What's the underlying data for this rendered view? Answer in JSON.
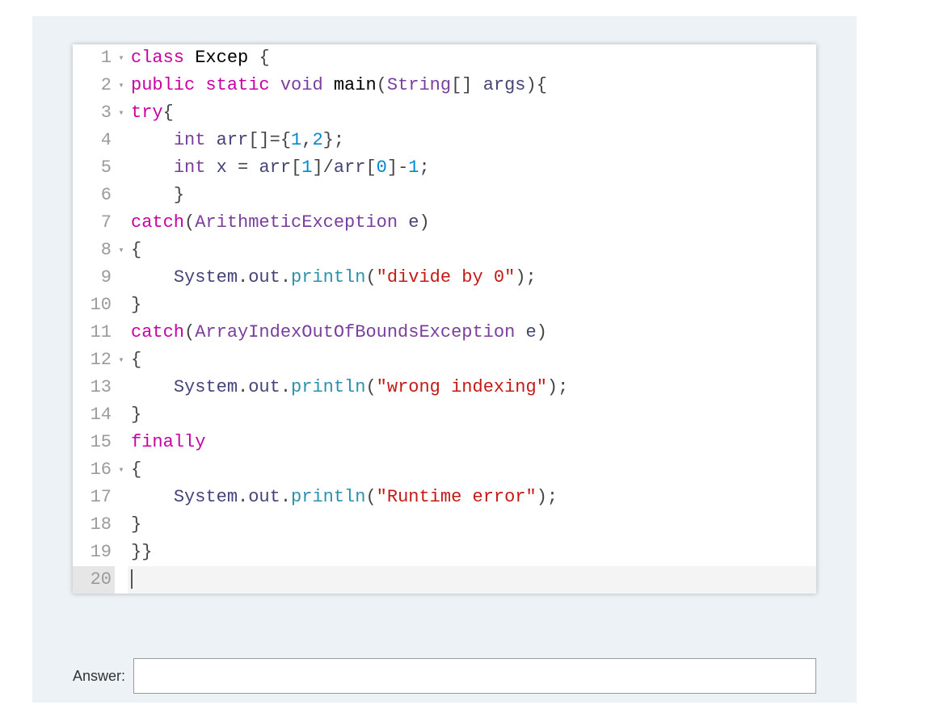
{
  "code": {
    "lines": [
      {
        "n": "1",
        "fold": true,
        "tokens": [
          {
            "c": "tok-kw",
            "t": "class"
          },
          {
            "c": "",
            "t": " "
          },
          {
            "c": "tok-name",
            "t": "Excep"
          },
          {
            "c": "",
            "t": " "
          },
          {
            "c": "tok-brace",
            "t": "{"
          }
        ]
      },
      {
        "n": "2",
        "fold": true,
        "tokens": [
          {
            "c": "tok-kw",
            "t": "public"
          },
          {
            "c": "",
            "t": " "
          },
          {
            "c": "tok-kw",
            "t": "static"
          },
          {
            "c": "",
            "t": " "
          },
          {
            "c": "tok-type",
            "t": "void"
          },
          {
            "c": "",
            "t": " "
          },
          {
            "c": "tok-name",
            "t": "main"
          },
          {
            "c": "tok-pun",
            "t": "("
          },
          {
            "c": "tok-type",
            "t": "String"
          },
          {
            "c": "tok-pun",
            "t": "[]"
          },
          {
            "c": "",
            "t": " "
          },
          {
            "c": "tok-id",
            "t": "args"
          },
          {
            "c": "tok-pun",
            "t": ")"
          },
          {
            "c": "tok-brace",
            "t": "{"
          }
        ]
      },
      {
        "n": "3",
        "fold": true,
        "tokens": [
          {
            "c": "tok-kw",
            "t": "try"
          },
          {
            "c": "tok-brace",
            "t": "{"
          }
        ]
      },
      {
        "n": "4",
        "fold": false,
        "tokens": [
          {
            "c": "",
            "t": "    "
          },
          {
            "c": "tok-type",
            "t": "int"
          },
          {
            "c": "",
            "t": " "
          },
          {
            "c": "tok-id",
            "t": "arr"
          },
          {
            "c": "tok-pun",
            "t": "[]="
          },
          {
            "c": "tok-brace",
            "t": "{"
          },
          {
            "c": "tok-num",
            "t": "1"
          },
          {
            "c": "tok-pun",
            "t": ","
          },
          {
            "c": "tok-num",
            "t": "2"
          },
          {
            "c": "tok-brace",
            "t": "}"
          },
          {
            "c": "tok-pun",
            "t": ";"
          }
        ]
      },
      {
        "n": "5",
        "fold": false,
        "tokens": [
          {
            "c": "",
            "t": "    "
          },
          {
            "c": "tok-type",
            "t": "int"
          },
          {
            "c": "",
            "t": " "
          },
          {
            "c": "tok-id",
            "t": "x"
          },
          {
            "c": "",
            "t": " "
          },
          {
            "c": "tok-pun",
            "t": "="
          },
          {
            "c": "",
            "t": " "
          },
          {
            "c": "tok-id",
            "t": "arr"
          },
          {
            "c": "tok-pun",
            "t": "["
          },
          {
            "c": "tok-num",
            "t": "1"
          },
          {
            "c": "tok-pun",
            "t": "]/"
          },
          {
            "c": "tok-id",
            "t": "arr"
          },
          {
            "c": "tok-pun",
            "t": "["
          },
          {
            "c": "tok-num",
            "t": "0"
          },
          {
            "c": "tok-pun",
            "t": "]-"
          },
          {
            "c": "tok-num",
            "t": "1"
          },
          {
            "c": "tok-pun",
            "t": ";"
          }
        ]
      },
      {
        "n": "6",
        "fold": false,
        "tokens": [
          {
            "c": "",
            "t": "    "
          },
          {
            "c": "tok-brace",
            "t": "}"
          }
        ]
      },
      {
        "n": "7",
        "fold": false,
        "tokens": [
          {
            "c": "tok-kw",
            "t": "catch"
          },
          {
            "c": "tok-pun",
            "t": "("
          },
          {
            "c": "tok-type",
            "t": "ArithmeticException"
          },
          {
            "c": "",
            "t": " "
          },
          {
            "c": "tok-id",
            "t": "e"
          },
          {
            "c": "tok-pun",
            "t": ")"
          }
        ]
      },
      {
        "n": "8",
        "fold": true,
        "tokens": [
          {
            "c": "tok-brace",
            "t": "{"
          }
        ]
      },
      {
        "n": "9",
        "fold": false,
        "tokens": [
          {
            "c": "",
            "t": "    "
          },
          {
            "c": "tok-id",
            "t": "System"
          },
          {
            "c": "tok-pun",
            "t": "."
          },
          {
            "c": "tok-id",
            "t": "out"
          },
          {
            "c": "tok-pun",
            "t": "."
          },
          {
            "c": "tok-call",
            "t": "println"
          },
          {
            "c": "tok-pun",
            "t": "("
          },
          {
            "c": "tok-str",
            "t": "\"divide by 0\""
          },
          {
            "c": "tok-pun",
            "t": ");"
          }
        ]
      },
      {
        "n": "10",
        "fold": false,
        "tokens": [
          {
            "c": "tok-brace",
            "t": "}"
          }
        ]
      },
      {
        "n": "11",
        "fold": false,
        "tokens": [
          {
            "c": "tok-kw",
            "t": "catch"
          },
          {
            "c": "tok-pun",
            "t": "("
          },
          {
            "c": "tok-type",
            "t": "ArrayIndexOutOfBoundsException"
          },
          {
            "c": "",
            "t": " "
          },
          {
            "c": "tok-id",
            "t": "e"
          },
          {
            "c": "tok-pun",
            "t": ")"
          }
        ]
      },
      {
        "n": "12",
        "fold": true,
        "tokens": [
          {
            "c": "tok-brace",
            "t": "{"
          }
        ]
      },
      {
        "n": "13",
        "fold": false,
        "tokens": [
          {
            "c": "",
            "t": "    "
          },
          {
            "c": "tok-id",
            "t": "System"
          },
          {
            "c": "tok-pun",
            "t": "."
          },
          {
            "c": "tok-id",
            "t": "out"
          },
          {
            "c": "tok-pun",
            "t": "."
          },
          {
            "c": "tok-call",
            "t": "println"
          },
          {
            "c": "tok-pun",
            "t": "("
          },
          {
            "c": "tok-str",
            "t": "\"wrong indexing\""
          },
          {
            "c": "tok-pun",
            "t": ");"
          }
        ]
      },
      {
        "n": "14",
        "fold": false,
        "tokens": [
          {
            "c": "tok-brace",
            "t": "}"
          }
        ]
      },
      {
        "n": "15",
        "fold": false,
        "tokens": [
          {
            "c": "tok-kw",
            "t": "finally"
          }
        ]
      },
      {
        "n": "16",
        "fold": true,
        "tokens": [
          {
            "c": "tok-brace",
            "t": "{"
          }
        ]
      },
      {
        "n": "17",
        "fold": false,
        "tokens": [
          {
            "c": "",
            "t": "    "
          },
          {
            "c": "tok-id",
            "t": "System"
          },
          {
            "c": "tok-pun",
            "t": "."
          },
          {
            "c": "tok-id",
            "t": "out"
          },
          {
            "c": "tok-pun",
            "t": "."
          },
          {
            "c": "tok-call",
            "t": "println"
          },
          {
            "c": "tok-pun",
            "t": "("
          },
          {
            "c": "tok-str",
            "t": "\"Runtime error\""
          },
          {
            "c": "tok-pun",
            "t": ");"
          }
        ]
      },
      {
        "n": "18",
        "fold": false,
        "tokens": [
          {
            "c": "tok-brace",
            "t": "}"
          }
        ]
      },
      {
        "n": "19",
        "fold": false,
        "tokens": [
          {
            "c": "tok-brace",
            "t": "}}"
          }
        ]
      },
      {
        "n": "20",
        "fold": false,
        "current": true,
        "cursor": true,
        "tokens": []
      }
    ],
    "fold_glyph": "▾"
  },
  "answer": {
    "label": "Answer:",
    "value": ""
  }
}
